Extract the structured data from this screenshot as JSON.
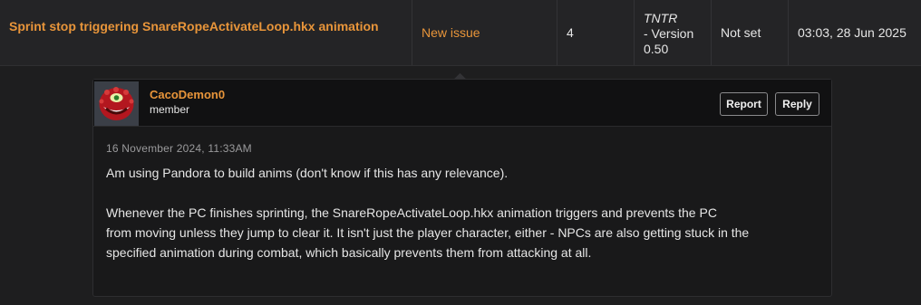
{
  "issue": {
    "title": "Sprint stop triggering SnareRopeActivateLoop.hkx animation",
    "status": "New issue",
    "count": "4",
    "version_line1": "TNTR",
    "version_line2": "- Version",
    "version_line3": "0.50",
    "priority": "Not set",
    "date": "03:03, 28 Jun 2025",
    "colors": {
      "accent": "#e8953a",
      "row_bg": "#242426"
    }
  },
  "comment": {
    "username": "CacoDemon0",
    "role": "member",
    "avatar_icon": "cacodemon-avatar",
    "report_label": "Report",
    "reply_label": "Reply",
    "timestamp": "16 November 2024, 11:33AM",
    "paragraph1": "Am using Pandora to build anims (don't know if this has any relevance).",
    "paragraph2_line1": "Whenever the PC finishes sprinting, the SnareRopeActivateLoop.hkx animation triggers and prevents the PC",
    "paragraph2_line2": "from moving unless they jump to clear it. It isn't just the player character, either - NPCs are also getting stuck in the",
    "paragraph2_line3": "specified animation during combat, which basically prevents them from attacking at all."
  }
}
